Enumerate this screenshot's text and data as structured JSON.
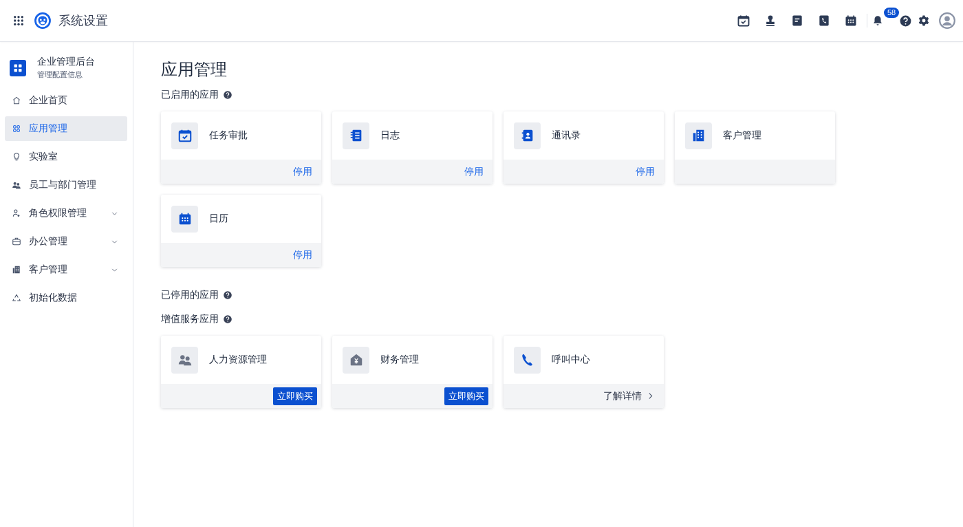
{
  "header": {
    "title": "系统设置",
    "tools": [
      {
        "kind": "calendar-check"
      },
      {
        "kind": "stamp"
      },
      {
        "kind": "document"
      },
      {
        "kind": "phonebook"
      },
      {
        "kind": "calendar"
      }
    ],
    "notifications": {
      "badge": "58"
    }
  },
  "sidebar": {
    "org": {
      "title": "企业管理后台",
      "subtitle": "管理配置信息"
    },
    "items": [
      {
        "kind": "home",
        "label": "企业首页",
        "selected": false
      },
      {
        "kind": "apps",
        "label": "应用管理",
        "selected": true
      },
      {
        "kind": "bulb",
        "label": "实验室",
        "selected": false
      },
      {
        "kind": "people",
        "label": "员工与部门管理",
        "selected": false
      },
      {
        "kind": "person",
        "label": "角色权限管理",
        "selected": false,
        "expanded": false
      },
      {
        "kind": "briefcase",
        "label": "办公管理",
        "selected": false,
        "expanded": false
      },
      {
        "kind": "building",
        "label": "客户管理",
        "selected": false,
        "expanded": false
      },
      {
        "kind": "recycle",
        "label": "初始化数据",
        "selected": false
      }
    ]
  },
  "main": {
    "title": "应用管理",
    "sections": [
      {
        "heading": "已启用的应用",
        "apps": [
          {
            "kind": "calendar-check",
            "color": "#0b50d0",
            "name": "任务审批",
            "action": {
              "kind": "link",
              "label": "停用"
            }
          },
          {
            "kind": "notebook",
            "color": "#0b50d0",
            "name": "日志",
            "action": {
              "kind": "link",
              "label": "停用"
            }
          },
          {
            "kind": "contact",
            "color": "#0b50d0",
            "name": "通讯录",
            "action": {
              "kind": "link",
              "label": "停用"
            }
          },
          {
            "kind": "building",
            "color": "#0b50d0",
            "name": "客户管理"
          },
          {
            "kind": "calendar",
            "color": "#0b50d0",
            "name": "日历",
            "action": {
              "kind": "link",
              "label": "停用"
            }
          }
        ]
      },
      {
        "heading": "已停用的应用"
      },
      {
        "heading": "增值服务应用",
        "apps": [
          {
            "kind": "people",
            "color": "#6b7385",
            "name": "人力资源管理",
            "action": {
              "kind": "button",
              "label": "立即购买"
            }
          },
          {
            "kind": "finance",
            "color": "#6b7385",
            "name": "财务管理",
            "action": {
              "kind": "button",
              "label": "立即购买"
            }
          },
          {
            "kind": "phone",
            "color": "#0b50d0",
            "name": "呼叫中心",
            "action": {
              "kind": "more",
              "label": "了解详情"
            }
          }
        ]
      }
    ]
  }
}
